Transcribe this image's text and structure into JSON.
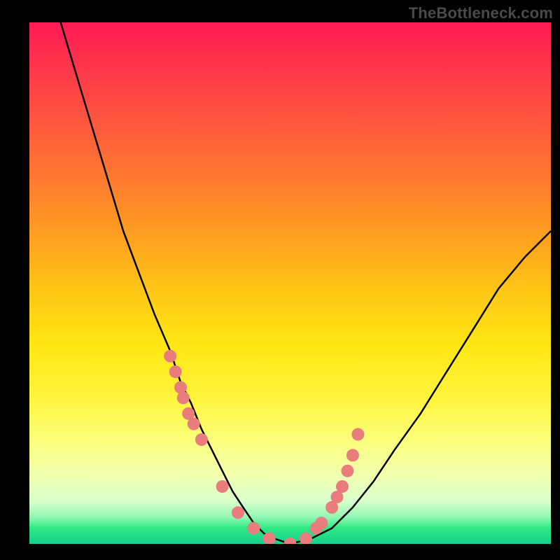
{
  "watermark": "TheBottleneck.com",
  "colors": {
    "background": "#000000",
    "dot": "#e97c7c",
    "curve": "#000000",
    "gradient_stops": [
      "#ff1a54",
      "#ff3a4a",
      "#ff5a3d",
      "#ff7a30",
      "#ffa31e",
      "#ffc815",
      "#ffe714",
      "#fff43d",
      "#fbff7a",
      "#f2ffb0",
      "#d6ffcc",
      "#8cf7b1",
      "#2de983",
      "#18cf8d"
    ]
  },
  "chart_data": {
    "type": "line",
    "title": "",
    "xlabel": "",
    "ylabel": "",
    "xlim": [
      0,
      100
    ],
    "ylim": [
      0,
      100
    ],
    "series": [
      {
        "name": "bottleneck-curve",
        "x": [
          6,
          9,
          12,
          15,
          18,
          21,
          24,
          27,
          29,
          31,
          33,
          35,
          37,
          39,
          41,
          43,
          45,
          47,
          50,
          54,
          58,
          62,
          66,
          70,
          75,
          80,
          85,
          90,
          95,
          100
        ],
        "y": [
          100,
          90,
          80,
          70,
          60,
          52,
          44,
          37,
          31,
          27,
          22,
          18,
          14,
          10,
          7,
          4,
          2,
          1,
          0,
          1,
          3,
          7,
          12,
          18,
          25,
          33,
          41,
          49,
          55,
          60
        ]
      }
    ],
    "highlight_points": {
      "name": "markers",
      "x": [
        27,
        28,
        29,
        29.5,
        30.5,
        31.5,
        33,
        37,
        40,
        43,
        46,
        50,
        53,
        55,
        56,
        58,
        59,
        60,
        61,
        62,
        63
      ],
      "y": [
        36,
        33,
        30,
        28,
        25,
        23,
        20,
        11,
        6,
        3,
        1,
        0,
        1,
        3,
        4,
        7,
        9,
        11,
        14,
        17,
        21
      ]
    }
  }
}
